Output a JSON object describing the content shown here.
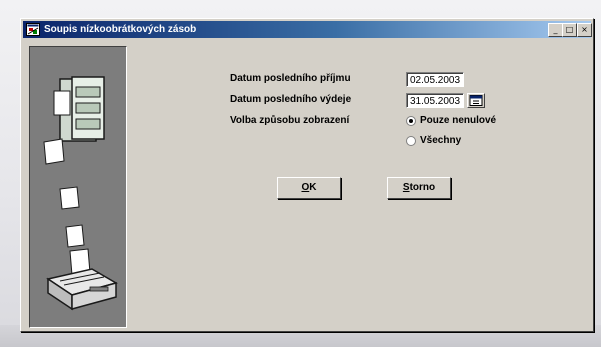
{
  "window": {
    "title": "Soupis nízkoobrátkových zásob",
    "minimize_glyph": "_",
    "maximize_glyph": "□",
    "close_glyph": "×"
  },
  "form": {
    "last_receipt_label": "Datum posledního příjmu",
    "last_receipt_value": "02.05.2003",
    "last_issue_label": "Datum posledního výdeje",
    "last_issue_value": "31.05.2003",
    "display_mode_label": "Volba způsobu zobrazení",
    "display_options": [
      {
        "label": "Pouze nenulové",
        "checked": true
      },
      {
        "label": "Všechny",
        "checked": false
      }
    ]
  },
  "buttons": {
    "ok_label": "OK",
    "cancel_label": "Storno"
  },
  "icons": {
    "app": "app-window-icon",
    "side_illustration": "print-report-illustration",
    "calendar": "calendar-icon"
  },
  "colors": {
    "titlebar_start": "#0a246a",
    "titlebar_end": "#a6caf0",
    "dialog_face": "#d4d0c8",
    "side_panel": "#7d7d7d"
  }
}
